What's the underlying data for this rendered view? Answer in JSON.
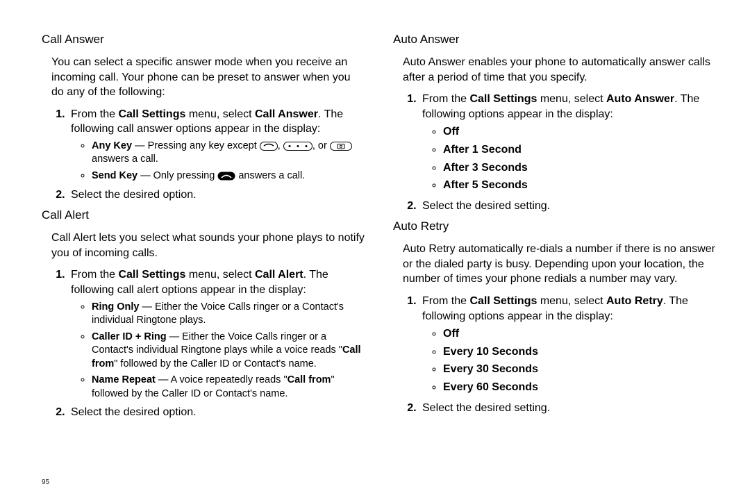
{
  "page_number": "95",
  "left": {
    "section1": {
      "title": "Call Answer",
      "intro": "You can select a specific answer mode when you receive an incoming call. Your phone can be preset to answer when you do any of the following:",
      "step1_a": "From the ",
      "step1_b": "Call Settings",
      "step1_c": " menu, select ",
      "step1_d": "Call Answer",
      "step1_e": ". The following call answer options appear in the display:",
      "anykey_label": "Any Key",
      "anykey_a": " — Pressing any key except ",
      "anykey_b": ", ",
      "anykey_c": ", or ",
      "anykey_d": " answers a call.",
      "sendkey_label": "Send Key",
      "sendkey_a": " — Only pressing ",
      "sendkey_b": " answers a call.",
      "step2": "Select the desired option."
    },
    "section2": {
      "title": "Call Alert",
      "intro": "Call Alert lets you select what sounds your phone plays to notify you of incoming calls.",
      "step1_a": "From the ",
      "step1_b": "Call Settings",
      "step1_c": " menu, select ",
      "step1_d": "Call Alert",
      "step1_e": ". The following call alert options appear in the display:",
      "ringonly_label": "Ring Only",
      "ringonly_text": " — Either the Voice Calls ringer or a Contact's individual Ringtone plays.",
      "cidring_label": "Caller ID + Ring",
      "cidring_a": " — Either the Voice Calls ringer or a Contact's individual Ringtone plays while a voice reads \"",
      "cidring_b": "Call from",
      "cidring_c": "\" followed by the Caller ID or Contact's name.",
      "namerep_label": "Name Repeat",
      "namerep_a": " — A voice repeatedly reads \"",
      "namerep_b": "Call from",
      "namerep_c": "\" followed by the Caller ID or Contact's name.",
      "step2": "Select the desired option."
    }
  },
  "right": {
    "section1": {
      "title": "Auto Answer",
      "intro": "Auto Answer enables your phone to automatically answer calls after a period of time that you specify.",
      "step1_a": "From the ",
      "step1_b": "Call Settings",
      "step1_c": " menu, select ",
      "step1_d": "Auto Answer",
      "step1_e": ". The following options appear in the display:",
      "opts": [
        "Off",
        "After 1 Second",
        "After 3 Seconds",
        "After 5 Seconds"
      ],
      "step2": "Select the desired setting."
    },
    "section2": {
      "title": "Auto Retry",
      "intro": "Auto Retry automatically re-dials a number if there is no answer or the dialed party is busy. Depending upon your location, the number of times your phone redials a number may vary.",
      "step1_a": "From the ",
      "step1_b": "Call Settings",
      "step1_c": " menu, select ",
      "step1_d": "Auto Retry",
      "step1_e": ". The following options appear in the display:",
      "opts": [
        "Off",
        "Every 10 Seconds",
        "Every 30 Seconds",
        "Every 60 Seconds"
      ],
      "step2": "Select the desired setting."
    }
  }
}
